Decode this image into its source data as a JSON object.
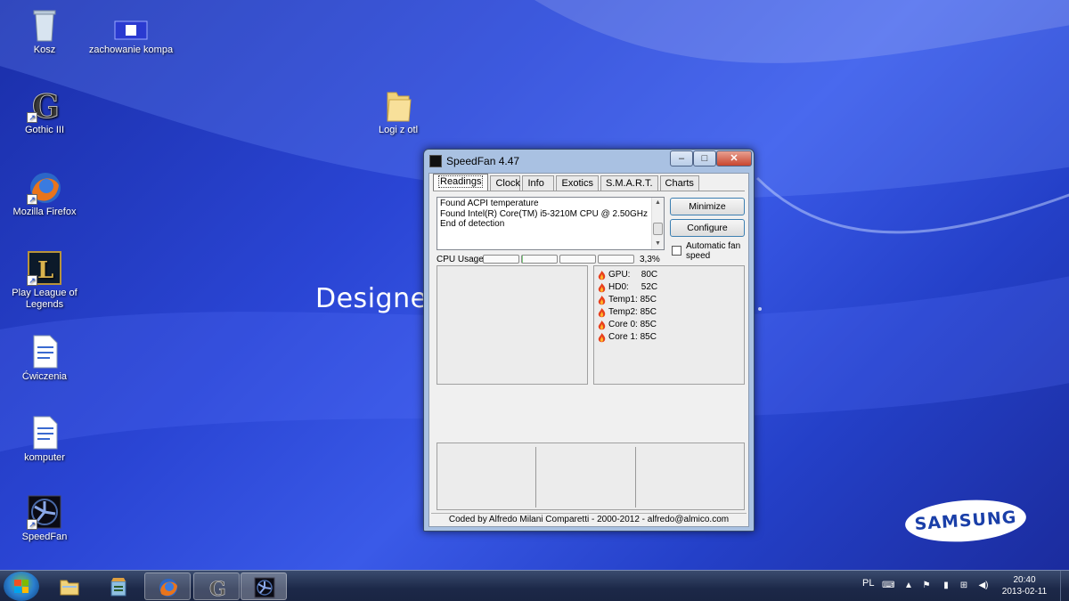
{
  "desktop": {
    "watermark": "Designed",
    "icons": [
      {
        "label": "Kosz"
      },
      {
        "label": "zachowanie kompa"
      },
      {
        "label": "Gothic III"
      },
      {
        "label": "Logi z otl"
      },
      {
        "label": "Mozilla Firefox"
      },
      {
        "label": "Play League of Legends"
      },
      {
        "label": "Ćwiczenia"
      },
      {
        "label": "komputer"
      },
      {
        "label": "SpeedFan"
      }
    ],
    "brand_logo": "SAMSUNG"
  },
  "window": {
    "title": "SpeedFan 4.47",
    "controls": {
      "minimize": "–",
      "maximize": "□",
      "close": "✕"
    },
    "tabs": [
      {
        "label": "Readings",
        "active": true
      },
      {
        "label": "Clock"
      },
      {
        "label": "Info"
      },
      {
        "label": "Exotics"
      },
      {
        "label": "S.M.A.R.T."
      },
      {
        "label": "Charts"
      }
    ],
    "log_lines": [
      "Found ACPI temperature",
      "Found Intel(R) Core(TM) i5-3210M CPU @ 2.50GHz",
      "End of detection"
    ],
    "buttons": {
      "minimize": "Minimize",
      "configure": "Configure"
    },
    "auto_fan_label": "Automatic fan speed",
    "auto_fan_checked": false,
    "cpu_usage_label": "CPU Usage",
    "cpu_usage_value": "3,3%",
    "cpu_bar_levels": [
      0,
      0.03,
      0,
      0
    ],
    "readings": [
      {
        "name": "GPU:",
        "value": "80C"
      },
      {
        "name": "HD0:",
        "value": "52C"
      },
      {
        "name": "Temp1:",
        "value": "85C"
      },
      {
        "name": "Temp2:",
        "value": "85C"
      },
      {
        "name": "Core 0:",
        "value": "85C"
      },
      {
        "name": "Core 1:",
        "value": "85C"
      }
    ],
    "status": "Coded by Alfredo Milani Comparetti - 2000-2012 - alfredo@almico.com"
  },
  "taskbar": {
    "items": [
      "start-button",
      "windows-explorer",
      "recycle",
      "firefox",
      "gothic",
      "speedfan"
    ],
    "language": "PL",
    "clock_time": "20:40",
    "clock_date": "2013-02-11"
  }
}
